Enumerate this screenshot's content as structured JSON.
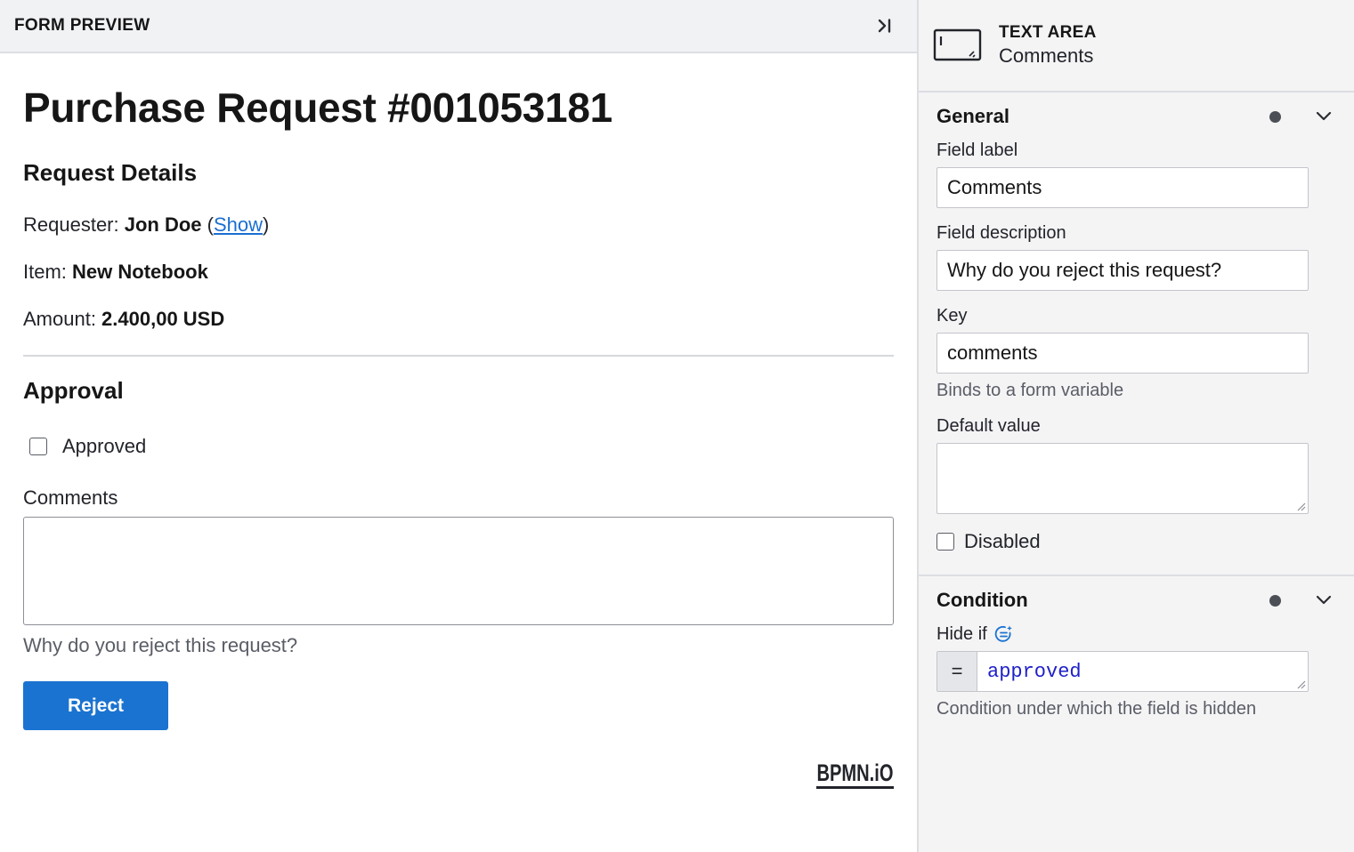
{
  "preview": {
    "title": "FORM PREVIEW"
  },
  "form": {
    "title": "Purchase Request #001053181",
    "details_heading": "Request Details",
    "requester_label": "Requester: ",
    "requester_value": "Jon Doe",
    "show_link_open": " (",
    "show_link": "Show",
    "show_link_close": ")",
    "item_label": "Item: ",
    "item_value": "New Notebook",
    "amount_label": "Amount: ",
    "amount_value": "2.400,00 USD",
    "approval_heading": "Approval",
    "approved_label": "Approved",
    "comments_label": "Comments",
    "comments_description": "Why do you reject this request?",
    "reject_label": "Reject",
    "logo_text": "BPMN.iO"
  },
  "properties": {
    "element_type": "TEXT AREA",
    "element_name": "Comments",
    "groups": {
      "general": {
        "title": "General",
        "field_label_label": "Field label",
        "field_label_value": "Comments",
        "field_description_label": "Field description",
        "field_description_value": "Why do you reject this request?",
        "key_label": "Key",
        "key_value": "comments",
        "key_help": "Binds to a form variable",
        "default_value_label": "Default value",
        "default_value": "",
        "disabled_label": "Disabled"
      },
      "condition": {
        "title": "Condition",
        "hide_if_label": "Hide if",
        "feel_prefix": "=",
        "hide_if_value": "approved",
        "hide_if_help": "Condition under which the field is hidden"
      }
    }
  },
  "colors": {
    "primary_button": "#1a73d0",
    "link": "#1a6fd1",
    "feel_expression": "#2020c8",
    "panel_background": "#f4f4f5"
  },
  "icons": [
    "collapse-panel-icon",
    "text-area-icon",
    "chevron-down-icon",
    "feel-icon",
    "resize-grip-icon"
  ]
}
